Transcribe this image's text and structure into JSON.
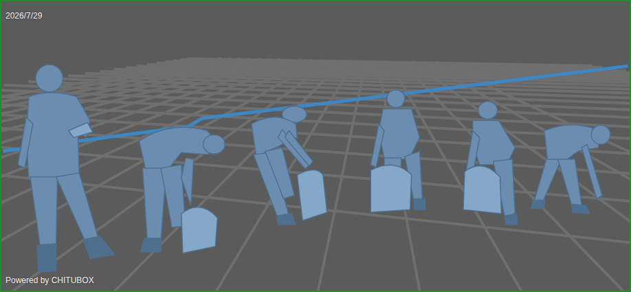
{
  "viewport": {
    "date": "2026/7/29",
    "watermark": "Powered by CHITUBOX"
  }
}
